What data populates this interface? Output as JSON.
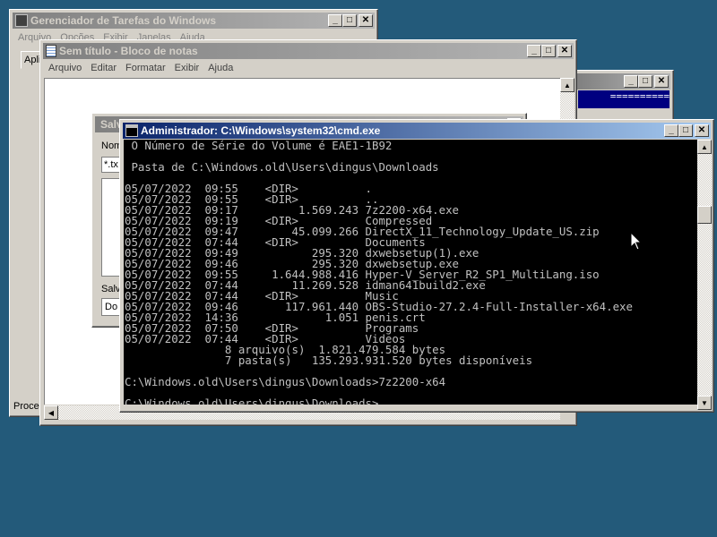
{
  "task_manager": {
    "title": "Gerenciador de Tarefas do Windows",
    "menu": [
      "Arquivo",
      "Opções",
      "Exibir",
      "Janelas",
      "Ajuda"
    ],
    "tab_label": "Apli",
    "status_label": "Proces"
  },
  "notepad": {
    "title": "Sem título - Bloco de notas",
    "menu": [
      "Arquivo",
      "Editar",
      "Formatar",
      "Exibir",
      "Ajuda"
    ]
  },
  "save_dialog": {
    "title_fragment": "Salv",
    "name_label": "Nom",
    "name_value": "*.tx",
    "save_as_label": "Salv",
    "encoding_value": "Do"
  },
  "blue_window": {
    "title_fragment": "=========="
  },
  "cmd": {
    "title": "Administrador: C:\\Windows\\system32\\cmd.exe",
    "lines": [
      " O Número de Série do Volume é EAE1-1B92",
      "",
      " Pasta de C:\\Windows.old\\Users\\dingus\\Downloads",
      "",
      "05/07/2022  09:55    <DIR>          .",
      "05/07/2022  09:55    <DIR>          ..",
      "05/07/2022  09:17         1.569.243 7z2200-x64.exe",
      "05/07/2022  09:19    <DIR>          Compressed",
      "05/07/2022  09:47        45.099.266 DirectX_11_Technology_Update_US.zip",
      "05/07/2022  07:44    <DIR>          Documents",
      "05/07/2022  09:49           295.320 dxwebsetup(1).exe",
      "05/07/2022  09:46           295.320 dxwebsetup.exe",
      "05/07/2022  09:55     1.644.988.416 Hyper-V_Server_R2_SP1_MultiLang.iso",
      "05/07/2022  07:44        11.269.528 idman641build2.exe",
      "05/07/2022  07:44    <DIR>          Music",
      "05/07/2022  09:46       117.961.440 OBS-Studio-27.2.4-Full-Installer-x64.exe",
      "05/07/2022  14:36             1.051 penis.crt",
      "05/07/2022  07:50    <DIR>          Programs",
      "05/07/2022  07:44    <DIR>          Videos",
      "               8 arquivo(s)  1.821.479.584 bytes",
      "               7 pasta(s)   135.293.931.520 bytes disponíveis",
      "",
      "C:\\Windows.old\\Users\\dingus\\Downloads>7z2200-x64",
      "",
      "C:\\Windows.old\\Users\\dingus\\Downloads>"
    ]
  },
  "colors": {
    "desktop": "#235a7a",
    "active_title_start": "#0a246a",
    "inactive_title": "#808080",
    "console_bg": "#000000",
    "console_fg": "#c0c0c0"
  },
  "icons": {
    "minimize": "minimize-icon",
    "maximize": "maximize-icon",
    "close": "close-icon",
    "cmd": "cmd-app-icon",
    "notepad": "notepad-app-icon",
    "task_manager": "task-manager-app-icon",
    "cursor": "mouse-pointer-icon"
  }
}
